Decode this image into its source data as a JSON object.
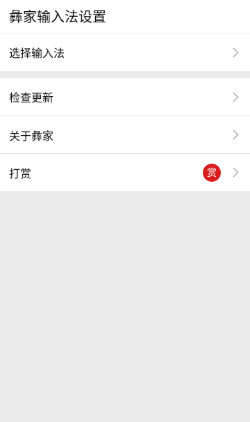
{
  "header": {
    "title": "彝家输入法设置"
  },
  "settings": {
    "select_ime": {
      "label": "选择输入法",
      "icon": "chevron-right-icon"
    },
    "check_update": {
      "label": "检查更新",
      "icon": "chevron-right-icon"
    },
    "about": {
      "label": "关于彝家",
      "icon": "chevron-right-icon"
    },
    "reward": {
      "label": "打赏",
      "badge": "赏",
      "badge_color": "#d81e1e",
      "icon": "chevron-right-icon"
    }
  },
  "colors": {
    "page_background": "#ebebeb",
    "card_background": "#ffffff",
    "divider": "#e6e6e6",
    "chevron": "#b3b3b3"
  }
}
